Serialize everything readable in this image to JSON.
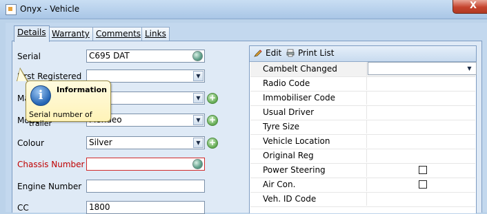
{
  "window": {
    "title": "Onyx - Vehicle",
    "close": "X"
  },
  "tabs": [
    {
      "label": "Details",
      "active": true
    },
    {
      "label": "Warranty"
    },
    {
      "label": "Comments"
    },
    {
      "label": "Links"
    }
  ],
  "fields": {
    "serial": {
      "label": "Serial",
      "value": "C695 DAT"
    },
    "first_registered": {
      "label": "First Registered",
      "value": ""
    },
    "make": {
      "label": "Make",
      "value": ""
    },
    "model": {
      "label": "Model",
      "value": "Mondeo"
    },
    "colour": {
      "label": "Colour",
      "value": "Silver"
    },
    "chassis_number": {
      "label": "Chassis Number",
      "value": ""
    },
    "engine_number": {
      "label": "Engine Number",
      "value": ""
    },
    "cc": {
      "label": "CC",
      "value": "1800"
    }
  },
  "tooltip": {
    "title": "Information",
    "text": "Serial number of trailer"
  },
  "right_toolbar": {
    "edit": "Edit",
    "print_list": "Print List"
  },
  "properties": [
    {
      "label": "Cambelt Changed",
      "type": "dropdown",
      "value": ""
    },
    {
      "label": "Radio Code",
      "type": "text",
      "value": ""
    },
    {
      "label": "Immobiliser Code",
      "type": "text",
      "value": ""
    },
    {
      "label": "Usual Driver",
      "type": "text",
      "value": ""
    },
    {
      "label": "Tyre Size",
      "type": "text",
      "value": ""
    },
    {
      "label": "Vehicle Location",
      "type": "text",
      "value": ""
    },
    {
      "label": "Original Reg",
      "type": "text",
      "value": ""
    },
    {
      "label": "Power Steering",
      "type": "checkbox",
      "checked": false
    },
    {
      "label": "Air Con.",
      "type": "checkbox",
      "checked": false
    },
    {
      "label": "Veh. ID Code",
      "type": "text",
      "value": ""
    }
  ],
  "colors": {
    "title_close": "#c5432d",
    "required_label": "#c00000",
    "tooltip_bg": "#fff3b8"
  },
  "icons": [
    "app-icon",
    "close-icon",
    "globe-icon",
    "dropdown-arrow-icon",
    "add-icon",
    "edit-icon",
    "print-icon",
    "info-icon"
  ]
}
